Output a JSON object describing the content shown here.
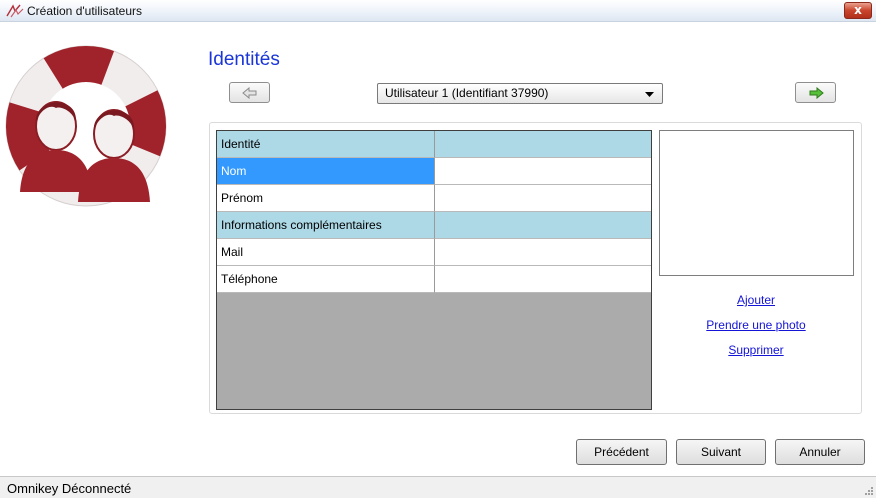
{
  "window": {
    "title": "Création d'utilisateurs",
    "close_label": "x"
  },
  "header": {
    "title": "Identités"
  },
  "navigator": {
    "selected_user": "Utilisateur 1 (Identifiant 37990)",
    "prev_icon": "arrow-left-icon",
    "next_icon": "arrow-right-icon"
  },
  "grid": {
    "rows": [
      {
        "type": "section",
        "label": "Identité",
        "value": ""
      },
      {
        "type": "field",
        "label": "Nom",
        "value": "",
        "selected": true
      },
      {
        "type": "field",
        "label": "Prénom",
        "value": ""
      },
      {
        "type": "section",
        "label": "Informations complémentaires",
        "value": ""
      },
      {
        "type": "field",
        "label": "Mail",
        "value": ""
      },
      {
        "type": "field",
        "label": "Téléphone",
        "value": ""
      }
    ]
  },
  "photo": {
    "add": "Ajouter",
    "take_photo": "Prendre une photo",
    "delete": "Supprimer"
  },
  "buttons": {
    "previous": "Précédent",
    "next": "Suivant",
    "cancel": "Annuler"
  },
  "status": {
    "text": "Omnikey Déconnecté"
  },
  "colors": {
    "section_row": "#add8e6",
    "selected_cell": "#3399ff",
    "title_blue": "#1a36d8",
    "link_blue": "#1414d6",
    "logo_red": "#a0232b"
  }
}
